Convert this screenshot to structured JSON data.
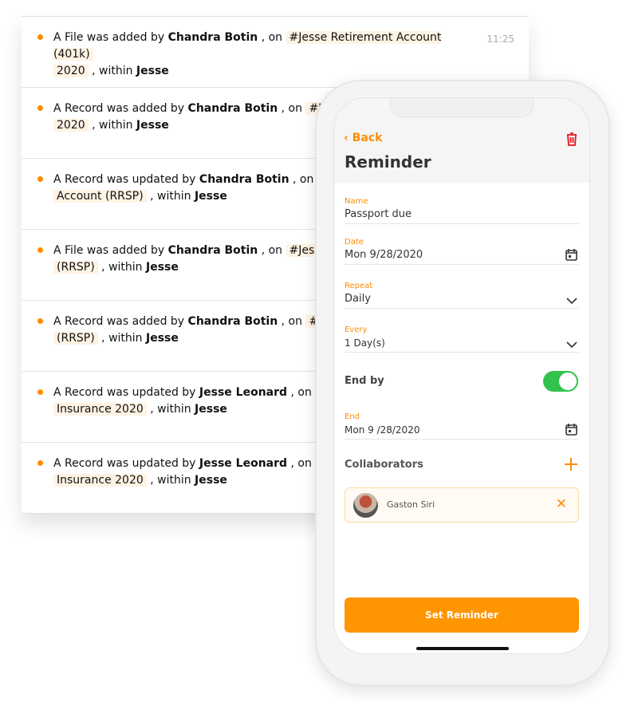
{
  "feed": {
    "items": [
      {
        "pre": "A File was added by ",
        "user": "Chandra Botin",
        "mid": " , on ",
        "tag1": "#Jesse Retirement Account (401k)",
        "tag2": "2020",
        "post": " , within ",
        "ws": "Jesse",
        "time": "11:25"
      },
      {
        "pre": "A Record was added by ",
        "user": "Chandra Botin",
        "mid": " , on ",
        "tag1": "#Je",
        "tag2": "2020",
        "post": " , within ",
        "ws": "Jesse"
      },
      {
        "pre": "A Record was updated by ",
        "user": "Chandra Botin",
        "mid": " , on ",
        "tag1": "#",
        "tag2": "Account (RRSP)",
        "post": " , within ",
        "ws": "Jesse"
      },
      {
        "pre": "A File was added by ",
        "user": "Chandra Botin",
        "mid": " , on ",
        "tag1": "#Jesse",
        "tag2": "(RRSP)",
        "post": " , within ",
        "ws": "Jesse"
      },
      {
        "pre": "A Record was added by ",
        "user": "Chandra Botin",
        "mid": " , on ",
        "tag1": "#Je",
        "tag2": "(RRSP)",
        "post": " , within ",
        "ws": "Jesse"
      },
      {
        "pre": "A Record was updated by ",
        "user": "Jesse Leonard",
        "mid": " , on ",
        "tag1": "#",
        "tag2": "Insurance 2020",
        "post": " , within ",
        "ws": "Jesse"
      },
      {
        "pre": "A Record was updated by ",
        "user": "Jesse Leonard",
        "mid": " , on ",
        "tag1": "#",
        "tag2": "Insurance 2020",
        "post": " , within ",
        "ws": "Jesse"
      }
    ]
  },
  "phone": {
    "back": "Back",
    "title": "Reminder",
    "name_label": "Name",
    "name_value": "Passport due",
    "date_label": "Date",
    "date_value": "Mon 9/28/2020",
    "repeat_label": "Repeat",
    "repeat_value": "Daily",
    "every_label": "Every",
    "every_value": "1 Day(s)",
    "endby_label": "End by",
    "endby_on": true,
    "end_label": "End",
    "end_value": "Mon 9 /28/2020",
    "collab_label": "Collaborators",
    "collaborators": [
      {
        "name": "Gaston Siri"
      }
    ],
    "submit": "Set Reminder"
  },
  "colors": {
    "accent": "#ff8c00",
    "toggle": "#33c24d",
    "delete": "#e8141b"
  }
}
